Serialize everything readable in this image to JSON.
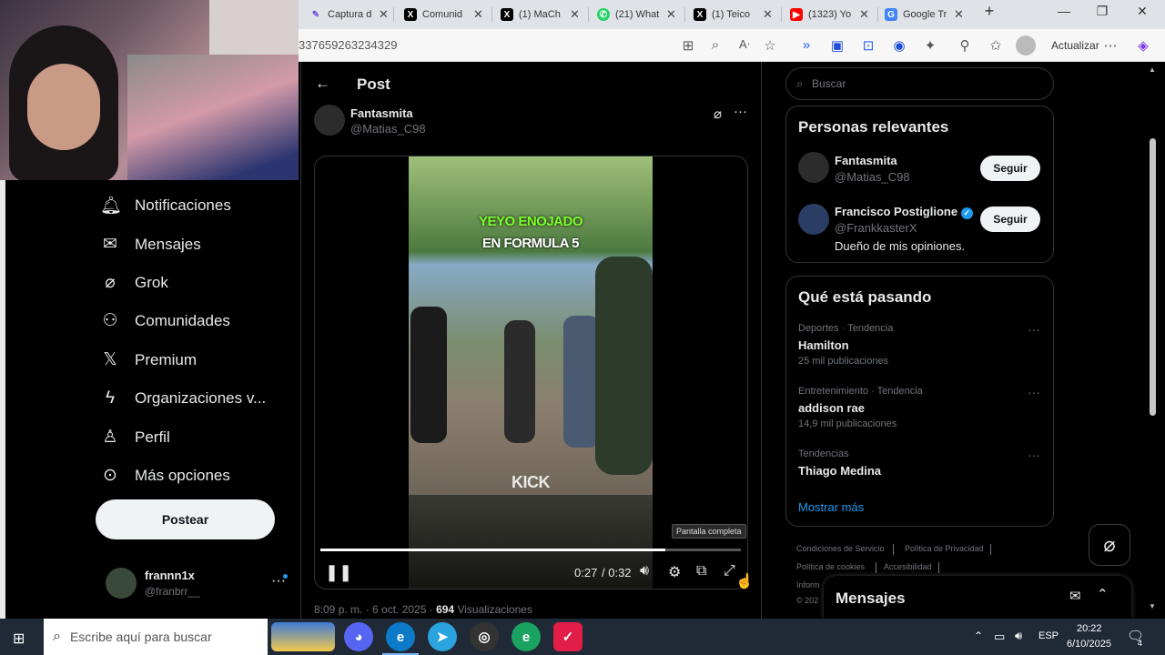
{
  "browser": {
    "tabs": [
      {
        "label": "Captura d",
        "icon": "pen-icon",
        "color": "#7b4fd6"
      },
      {
        "label": "Comunid",
        "icon": "x-icon",
        "color": "#000000"
      },
      {
        "label": "(1) MaCh",
        "icon": "x-icon",
        "color": "#000000"
      },
      {
        "label": "(21) What",
        "icon": "whatsapp-icon",
        "color": "#25d366"
      },
      {
        "label": "(1) Teico",
        "icon": "x-icon",
        "color": "#000000"
      },
      {
        "label": "(1323) Yo",
        "icon": "youtube-icon",
        "color": "#ff0000"
      },
      {
        "label": "Google Tr",
        "icon": "google-translate-icon",
        "color": "#4285f4"
      }
    ],
    "url": "337659263234329",
    "update_label": "Actualizar"
  },
  "sidebar": {
    "items": [
      {
        "label": "Notificaciones",
        "icon": "bell-icon"
      },
      {
        "label": "Mensajes",
        "icon": "mail-icon"
      },
      {
        "label": "Grok",
        "icon": "grok-icon"
      },
      {
        "label": "Comunidades",
        "icon": "communities-icon"
      },
      {
        "label": "Premium",
        "icon": "x-icon"
      },
      {
        "label": "Organizaciones v...",
        "icon": "lightning-icon"
      },
      {
        "label": "Perfil",
        "icon": "person-icon"
      },
      {
        "label": "Más opciones",
        "icon": "more-circle-icon"
      }
    ],
    "post_button": "Postear",
    "account": {
      "name": "frannn1x",
      "handle": "@franbrr__"
    }
  },
  "post": {
    "header_title": "Post",
    "author_name": "Fantasmita",
    "author_handle": "@Matias_C98",
    "video_caption_line1": "YEYO ENOJADO",
    "video_caption_line2": "EN FORMULA 5",
    "video_watermark": "KICK",
    "tooltip": "Pantalla completa",
    "time_current": "0:27",
    "time_total": "/ 0:32",
    "progress": 0.82,
    "timestamp": "8:09 p. m. · 6 oct. 2025 · ",
    "views_count": "694",
    "views_label": " Visualizaciones"
  },
  "right": {
    "search_placeholder": "Buscar",
    "relevant_title": "Personas relevantes",
    "people": [
      {
        "name": "Fantasmita",
        "handle": "@Matias_C98",
        "bio": "",
        "follow": "Seguir"
      },
      {
        "name": "Francisco Postiglione",
        "handle": "@FrankkasterX",
        "bio": "Dueño de mis opiniones.",
        "follow": "Seguir",
        "verified": true
      }
    ],
    "trends_title": "Qué está pasando",
    "trends": [
      {
        "meta": "Deportes · Tendencia",
        "name": "Hamilton",
        "count": "25 mil publicaciones"
      },
      {
        "meta": "Entretenimiento · Tendencia",
        "name": "addison rae",
        "count": "14,9 mil publicaciones"
      },
      {
        "meta": "Tendencias",
        "name": "Thiago Medina",
        "count": ""
      }
    ],
    "show_more": "Mostrar más",
    "footer_links": [
      "Condiciones de Servicio",
      "Política de Privacidad",
      "Política de cookies",
      "Accesibilidad"
    ],
    "footer_more_1": "Inform",
    "footer_more_2": "© 202",
    "messages_title": "Mensajes"
  },
  "taskbar": {
    "search_placeholder": "Escribe aquí para buscar",
    "lang": "ESP",
    "time": "20:22",
    "date": "6/10/2025",
    "notif_count": "4"
  },
  "colors": {
    "accent": "#1d9bf0",
    "background": "#000000",
    "text": "#e7e9ea",
    "muted": "#71767b"
  }
}
